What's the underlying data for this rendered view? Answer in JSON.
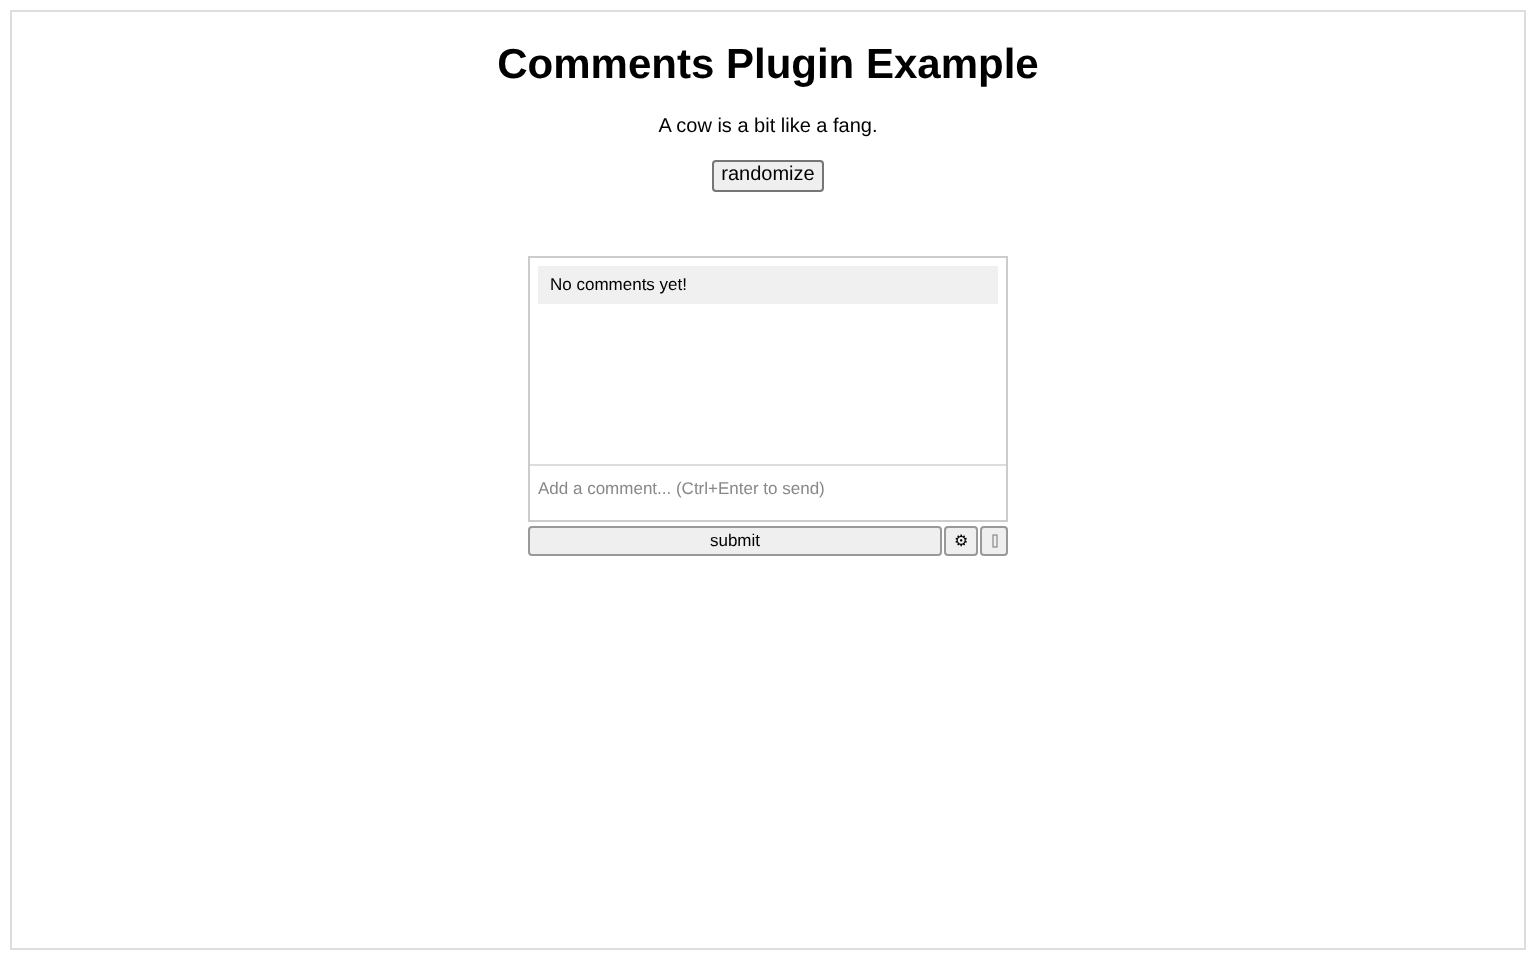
{
  "title": "Comments Plugin Example",
  "sentence": "A cow is a bit like a fang.",
  "randomize_button": "randomize",
  "comments": {
    "empty_message": "No comments yet!",
    "input": {
      "placeholder": "Add a comment... (Ctrl+Enter to send)"
    },
    "submit_button": "submit",
    "settings_button": "⚙"
  }
}
